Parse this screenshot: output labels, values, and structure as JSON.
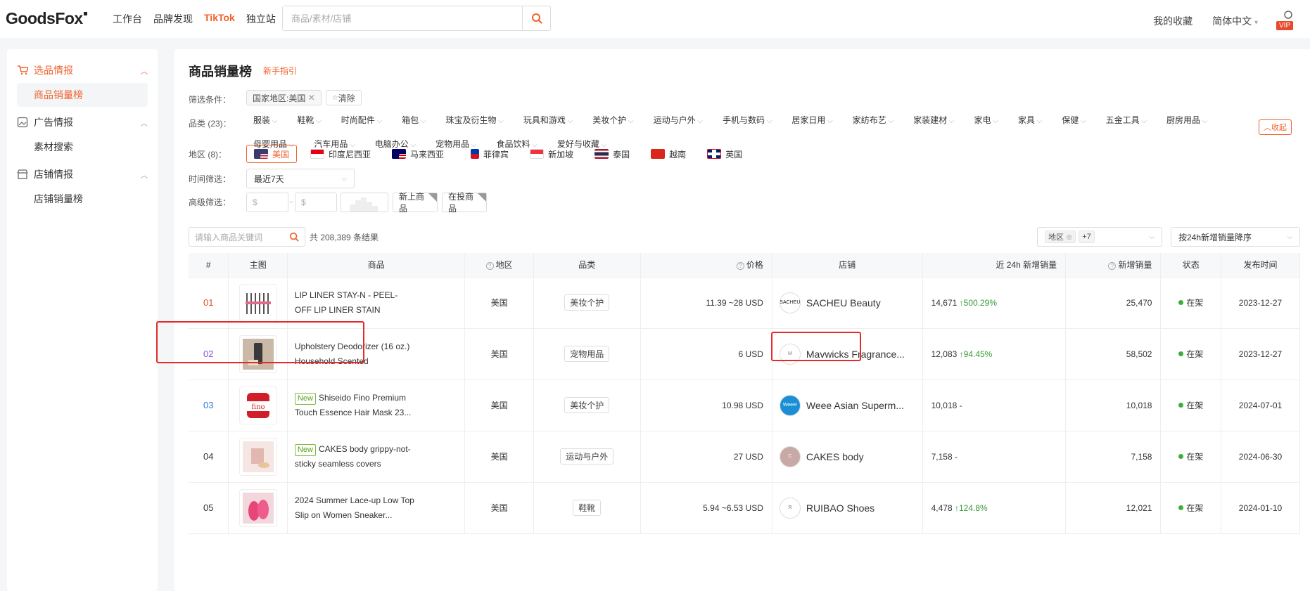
{
  "app": {
    "logo": "GoodsFox",
    "nav": [
      "工作台",
      "品牌发现",
      "TikTok",
      "独立站"
    ],
    "active_nav": "TikTok"
  },
  "search": {
    "placeholder": "商品/素材/店铺"
  },
  "topright": {
    "favorites": "我的收藏",
    "language": "简体中文",
    "vip": "VIP"
  },
  "sidebar": {
    "groups": [
      {
        "title": "选品情报",
        "items": [
          "商品销量榜"
        ]
      },
      {
        "title": "广告情报",
        "items": [
          "素材搜索"
        ]
      },
      {
        "title": "店铺情报",
        "items": [
          "店铺销量榜"
        ]
      }
    ]
  },
  "page": {
    "title": "商品销量榜",
    "guide": "新手指引"
  },
  "filters": {
    "conditions_label": "筛选条件：",
    "condition_chip": "国家地区:美国",
    "clear": "清除",
    "category_label": "品类 (23)：",
    "categories": [
      "服装",
      "鞋靴",
      "时尚配件",
      "箱包",
      "珠宝及衍生物",
      "玩具和游戏",
      "美妆个护",
      "运动与户外",
      "手机与数码",
      "居家日用",
      "家纺布艺",
      "家装建材",
      "家电",
      "家具",
      "保健",
      "五金工具",
      "厨房用品",
      "母婴用品",
      "汽车用品",
      "电脑办公",
      "宠物用品",
      "食品饮料",
      "爱好与收藏"
    ],
    "collapse": "收起",
    "region_label": "地区 (8)：",
    "regions": [
      "美国",
      "印度尼西亚",
      "马来西亚",
      "菲律宾",
      "新加坡",
      "泰国",
      "越南",
      "英国"
    ],
    "time_label": "时间筛选：",
    "time_value": "最近7天",
    "advanced_label": "高级筛选：",
    "price_min_placeholder": "$",
    "price_max_placeholder": "$",
    "new_products": "新上商品",
    "ad_products": "在投商品"
  },
  "list": {
    "keyword_placeholder": "请输入商品关键词",
    "results": "共 208,389 条结果",
    "region_select": "地区",
    "region_more": "+7",
    "sort": "按24h新增销量降序"
  },
  "table": {
    "headers": {
      "rank": "#",
      "image": "主图",
      "product": "商品",
      "region": "地区",
      "category": "品类",
      "price": "价格",
      "shop": "店铺",
      "sales24h": "近 24h 新增销量",
      "new_sales": "新增销量",
      "status": "状态",
      "published": "发布时间"
    },
    "rows": [
      {
        "rank": "01",
        "name": "LIP LINER STAY-N - PEEL-OFF LIP LINER STAIN",
        "is_new": false,
        "region": "美国",
        "category": "美妆个护",
        "price": "11.39 ~28 USD",
        "shop": "SACHEU Beauty",
        "shop_logo": "SACHEU",
        "sales24h": "14,671",
        "growth": "500.29%",
        "new_sales": "25,470",
        "status": "在架",
        "published": "2023-12-27",
        "rank_color": "#e8492c"
      },
      {
        "rank": "02",
        "name": "Upholstery Deodorizer (16 oz.) Household Scented",
        "is_new": false,
        "region": "美国",
        "category": "宠物用品",
        "price": "6 USD",
        "shop": "Mavwicks Fragrance...",
        "shop_logo": "M",
        "sales24h": "12,083",
        "growth": "94.45%",
        "new_sales": "58,502",
        "status": "在架",
        "published": "2023-12-27",
        "rank_color": "#8a4fd6"
      },
      {
        "rank": "03",
        "name": "Shiseido Fino Premium Touch Essence Hair Mask 23...",
        "is_new": true,
        "new_label": "New",
        "region": "美国",
        "category": "美妆个护",
        "price": "10.98 USD",
        "shop": "Weee Asian Superm...",
        "shop_logo": "Weee!",
        "sales24h": "10,018",
        "growth": "-",
        "new_sales": "10,018",
        "status": "在架",
        "published": "2024-07-01",
        "rank_color": "#2a7fd6"
      },
      {
        "rank": "04",
        "name": "CAKES body grippy-not-sticky seamless covers",
        "is_new": true,
        "new_label": "New",
        "region": "美国",
        "category": "运动与户外",
        "price": "27 USD",
        "shop": "CAKES body",
        "shop_logo": "C",
        "sales24h": "7,158",
        "growth": "-",
        "new_sales": "7,158",
        "status": "在架",
        "published": "2024-06-30",
        "rank_color": "#333333"
      },
      {
        "rank": "05",
        "name": "2024 Summer Lace-up Low Top Slip on Women Sneaker...",
        "is_new": false,
        "region": "美国",
        "category": "鞋靴",
        "price": "5.94 ~6.53 USD",
        "shop": "RUIBAO Shoes",
        "shop_logo": "R",
        "sales24h": "4,478",
        "growth": "124.8%",
        "new_sales": "12,021",
        "status": "在架",
        "published": "2024-01-10",
        "rank_color": "#333333"
      }
    ]
  },
  "colors": {
    "accent": "#f0612b",
    "highlight": "#e52a2a",
    "status": "#3ab03a"
  }
}
